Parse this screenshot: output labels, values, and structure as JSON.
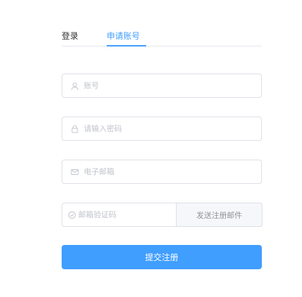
{
  "tabs": {
    "login_label": "登录",
    "register_label": "申请账号",
    "active": "register"
  },
  "form": {
    "account_placeholder": "账号",
    "password_placeholder": "请输入密码",
    "email_placeholder": "电子邮箱",
    "code_placeholder": "邮箱验证码",
    "send_code_label": "发送注册邮件",
    "submit_label": "提交注册"
  },
  "icons": {
    "account": "user-icon",
    "password": "lock-icon",
    "email": "message-icon",
    "code": "check-circle-icon"
  },
  "colors": {
    "accent": "#409eff",
    "border": "#dcdfe6",
    "placeholder": "#c0c4cc"
  }
}
